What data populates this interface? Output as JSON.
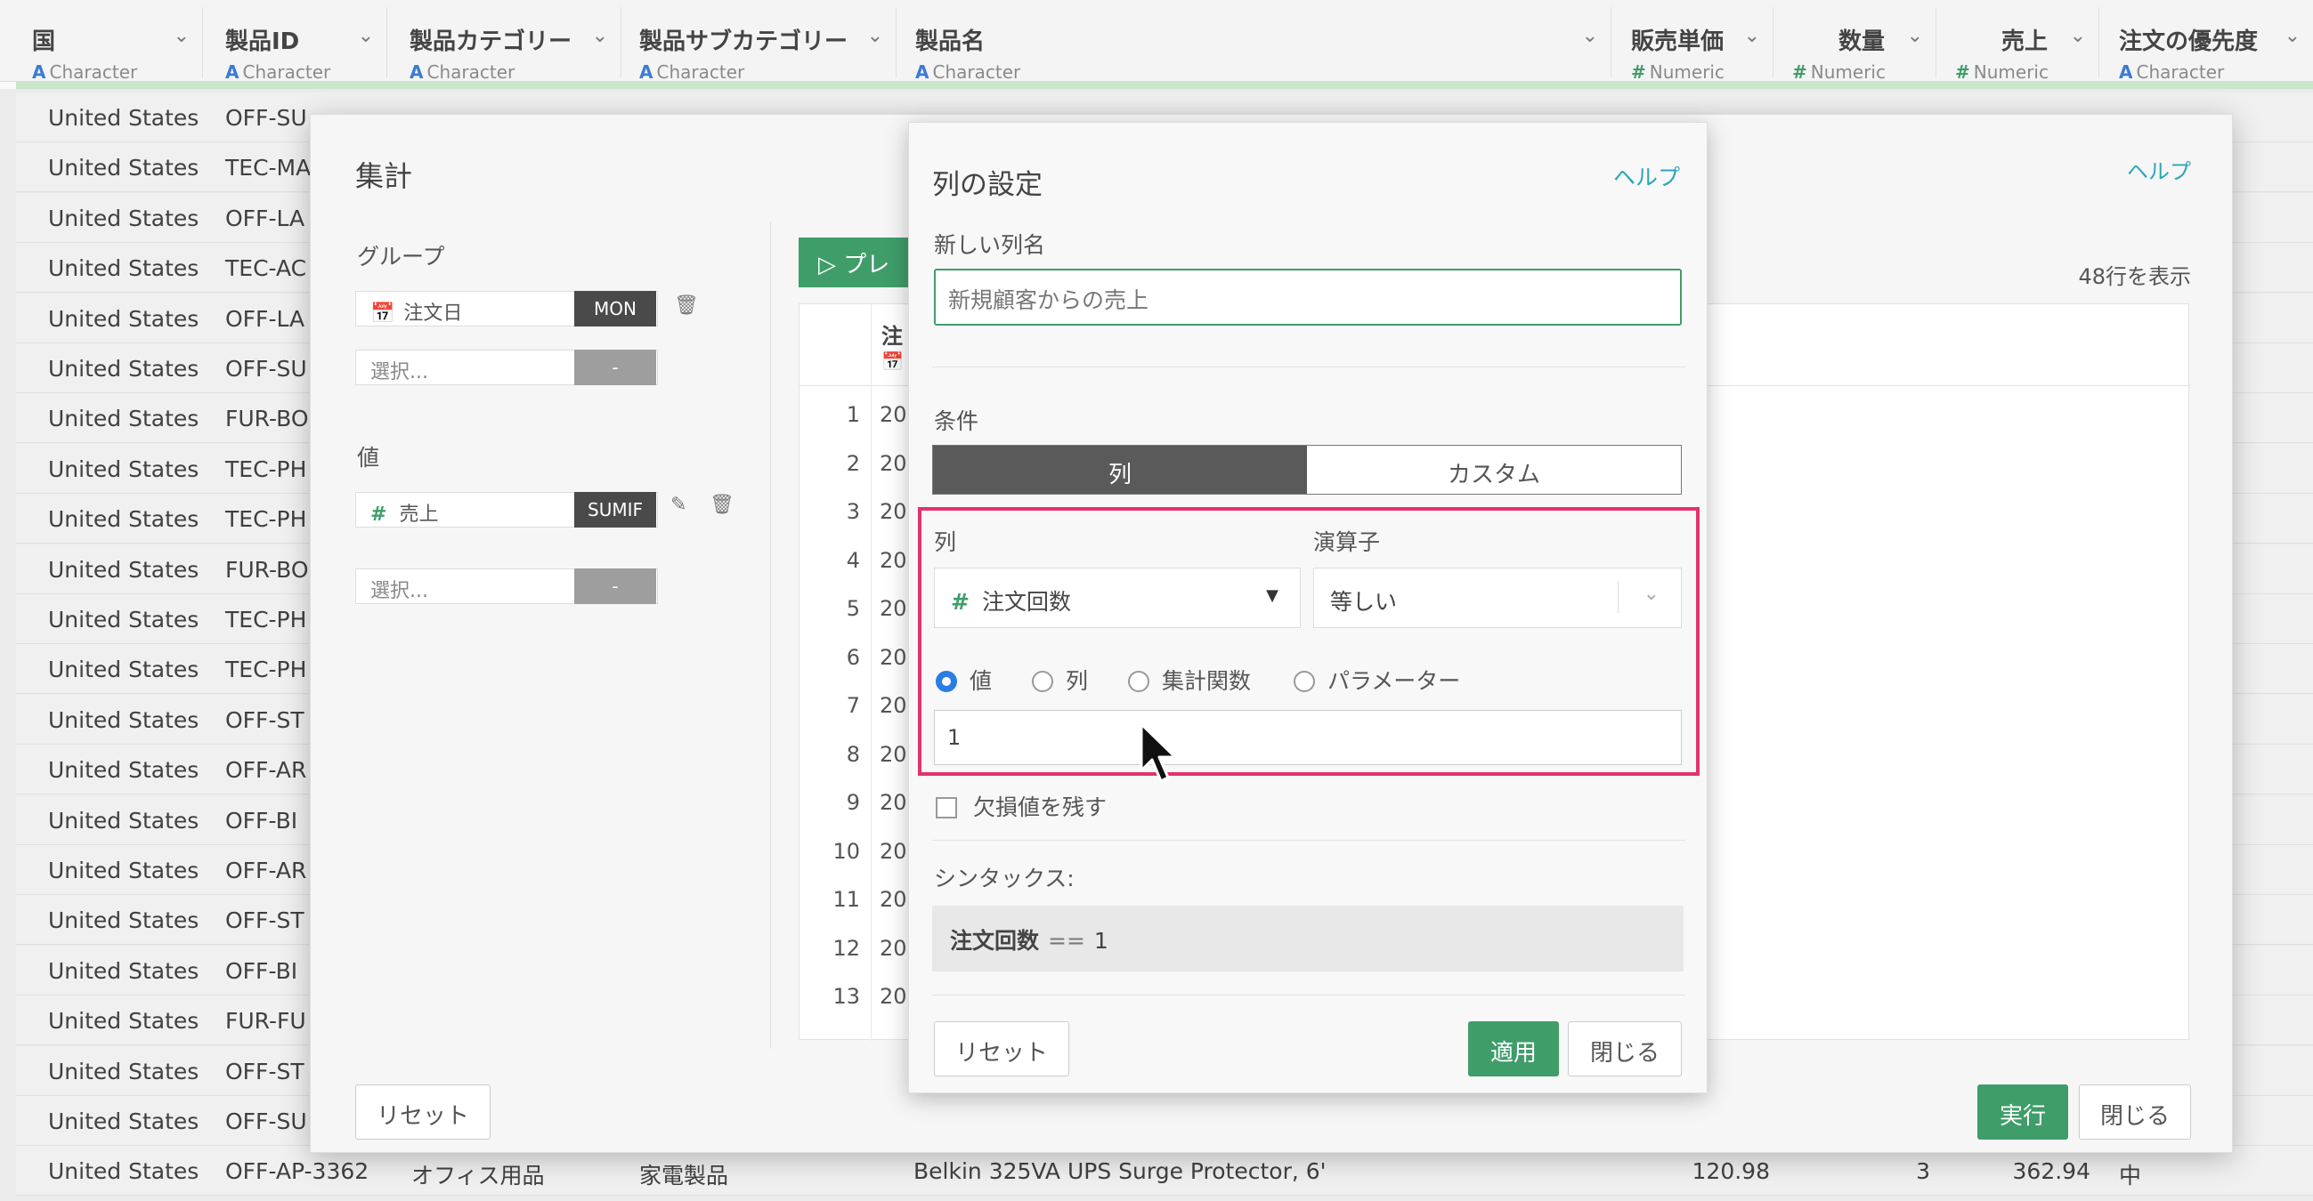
{
  "grid": {
    "columns": [
      {
        "name": "国",
        "type_icon": "A",
        "type": "Character"
      },
      {
        "name": "製品ID",
        "type_icon": "A",
        "type": "Character"
      },
      {
        "name": "製品カテゴリー",
        "type_icon": "A",
        "type": "Character"
      },
      {
        "name": "製品サブカテゴリー",
        "type_icon": "A",
        "type": "Character"
      },
      {
        "name": "製品名",
        "type_icon": "A",
        "type": "Character"
      },
      {
        "name": "販売単価",
        "type_icon": "#",
        "type": "Numeric"
      },
      {
        "name": "数量",
        "type_icon": "#",
        "type": "Numeric"
      },
      {
        "name": "売上",
        "type_icon": "#",
        "type": "Numeric"
      },
      {
        "name": "注文の優先度",
        "type_icon": "A",
        "type": "Character"
      }
    ],
    "rows": [
      [
        "United States",
        "OFF-SU"
      ],
      [
        "United States",
        "TEC-MA"
      ],
      [
        "United States",
        "OFF-LA"
      ],
      [
        "United States",
        "TEC-AC"
      ],
      [
        "United States",
        "OFF-LA"
      ],
      [
        "United States",
        "OFF-SU"
      ],
      [
        "United States",
        "FUR-BO"
      ],
      [
        "United States",
        "TEC-PH"
      ],
      [
        "United States",
        "TEC-PH"
      ],
      [
        "United States",
        "FUR-BO"
      ],
      [
        "United States",
        "TEC-PH"
      ],
      [
        "United States",
        "TEC-PH"
      ],
      [
        "United States",
        "OFF-ST"
      ],
      [
        "United States",
        "OFF-AR"
      ],
      [
        "United States",
        "OFF-BI"
      ],
      [
        "United States",
        "OFF-AR"
      ],
      [
        "United States",
        "OFF-ST"
      ],
      [
        "United States",
        "OFF-BI"
      ],
      [
        "United States",
        "FUR-FU"
      ],
      [
        "United States",
        "OFF-ST"
      ],
      [
        "United States",
        "OFF-SU"
      ]
    ],
    "last_row": {
      "country": "United States",
      "product_id": "OFF-AP-3362",
      "category": "オフィス用品",
      "subcategory": "家電製品",
      "product_name": "Belkin 325VA UPS Surge Protector, 6'",
      "unit_price": "120.98",
      "quantity": "3",
      "sales": "362.94",
      "priority": "中"
    }
  },
  "aggregate": {
    "title": "集計",
    "help": "ヘルプ",
    "group_label": "グループ",
    "group_item": "注文日",
    "group_tag": "MON",
    "select_placeholder": "選択...",
    "dash": "-",
    "value_label": "値",
    "value_item": "売上",
    "value_tag": "SUMIF",
    "preview_button": "プレ",
    "rows_count": "48行を表示",
    "table_header": "注",
    "row_indexes": [
      "1",
      "2",
      "3",
      "4",
      "5",
      "6",
      "7",
      "8",
      "9",
      "10",
      "11",
      "12",
      "13"
    ],
    "row_value_prefix": "20",
    "reset": "リセット",
    "run": "実行",
    "close": "閉じる"
  },
  "column_settings": {
    "title": "列の設定",
    "help": "ヘルプ",
    "new_name_label": "新しい列名",
    "new_name_value": "新規顧客からの売上",
    "condition_label": "条件",
    "tab_column": "列",
    "tab_custom": "カスタム",
    "column_label": "列",
    "operator_label": "演算子",
    "column_value": "注文回数",
    "operator_value": "等しい",
    "radio_value": "値",
    "radio_column": "列",
    "radio_aggregate": "集計関数",
    "radio_parameter": "パラメーター",
    "input_value": "1",
    "keep_na": "欠損値を残す",
    "syntax_label": "シンタックス:",
    "syntax_column": "注文回数",
    "syntax_operator": "==",
    "syntax_value": "1",
    "reset": "リセット",
    "apply": "適用",
    "close": "閉じる"
  },
  "colors": {
    "accent_green": "#3f9d6a",
    "highlight": "#e0336f",
    "help_link": "#2aa7b8"
  }
}
